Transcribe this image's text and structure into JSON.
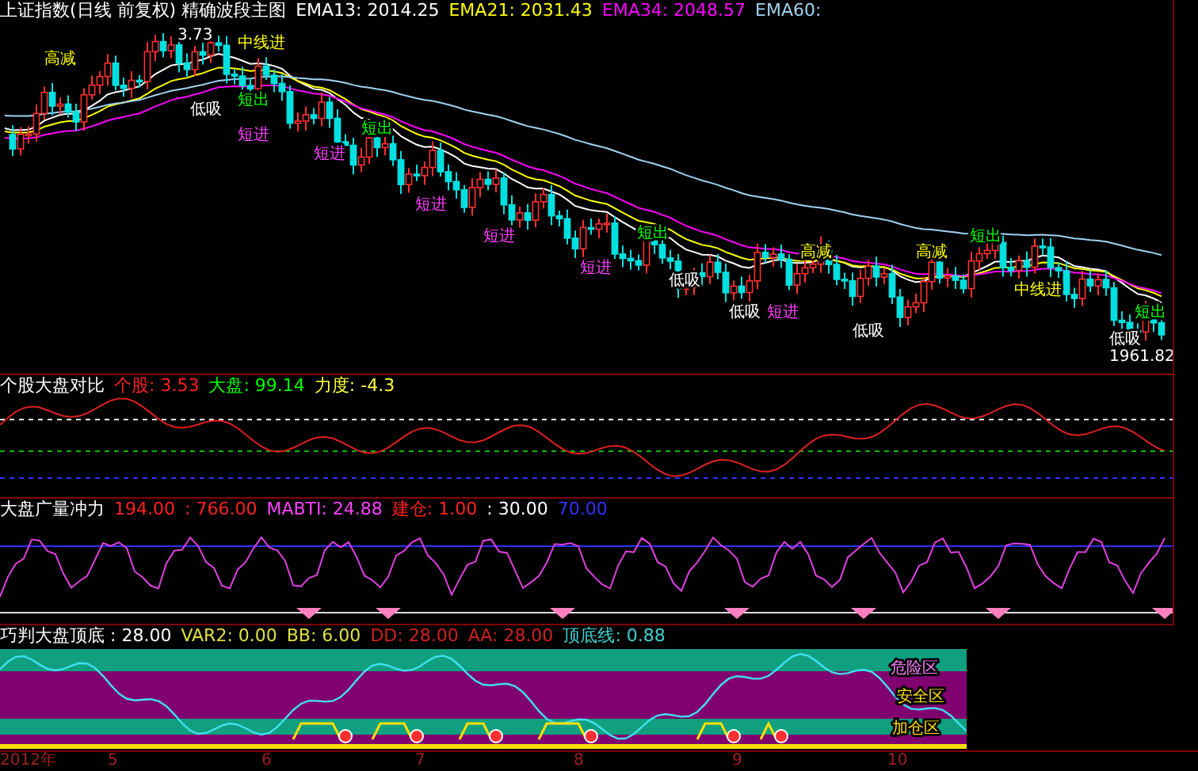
{
  "main_chart": {
    "title": "上证指数(日线 前复权) 精确波段主图",
    "indicators": [
      {
        "label": "EMA13: 2014.25",
        "color": "#ffffff"
      },
      {
        "label": "EMA21: 2031.43",
        "color": "#ffff00"
      },
      {
        "label": "EMA34: 2048.57",
        "color": "#ff00ff"
      },
      {
        "label": "EMA60:",
        "color": "#9fd3f0"
      }
    ],
    "price_labels": [
      "3.73",
      "1961.82"
    ],
    "signals": [
      {
        "text": "高减",
        "color": "#ffff00"
      },
      {
        "text": "中线进",
        "color": "#ffff00"
      },
      {
        "text": "低吸",
        "color": "#ffffff"
      },
      {
        "text": "短出",
        "color": "#00ff00"
      },
      {
        "text": "短进",
        "color": "#ff40ff"
      },
      {
        "text": "短出",
        "color": "#00ff00"
      },
      {
        "text": "短进",
        "color": "#ff40ff"
      },
      {
        "text": "短进",
        "color": "#ff40ff"
      },
      {
        "text": "短进",
        "color": "#ff40ff"
      },
      {
        "text": "短进",
        "color": "#ff40ff"
      },
      {
        "text": "短出",
        "color": "#00ff00"
      },
      {
        "text": "低吸",
        "color": "#ffffff"
      },
      {
        "text": "低吸",
        "color": "#ffffff"
      },
      {
        "text": "短进",
        "color": "#ff40ff"
      },
      {
        "text": "高减",
        "color": "#ffff00"
      },
      {
        "text": "低吸",
        "color": "#ffffff"
      },
      {
        "text": "高减",
        "color": "#ffff00"
      },
      {
        "text": "短出",
        "color": "#00ff00"
      },
      {
        "text": "中线进",
        "color": "#ffff00"
      },
      {
        "text": "低吸",
        "color": "#ffffff"
      },
      {
        "text": "短出",
        "color": "#00ff00"
      }
    ]
  },
  "compare_panel": {
    "title": "个股大盘对比",
    "values": [
      {
        "label": "个股: 3.53",
        "color": "#ff2020"
      },
      {
        "label": "大盘: 99.14",
        "color": "#00ff00"
      },
      {
        "label": "力度: -4.3",
        "color": "#ffff40"
      }
    ]
  },
  "volume_panel": {
    "title": "大盘广量冲力",
    "values": [
      {
        "label": "194.00",
        "color": "#ff2020"
      },
      {
        "label": ": 766.00",
        "color": "#ff2020"
      },
      {
        "label": "MABTI: 24.88",
        "color": "#ff40ff"
      },
      {
        "label": "建仓: 1.00",
        "color": "#ff2020"
      },
      {
        "label": ": 30.00",
        "color": "#ffffff"
      },
      {
        "label": "70.00",
        "color": "#3030ff"
      }
    ]
  },
  "top_bottom_panel": {
    "title": "巧判大盘顶底 : 28.00",
    "values": [
      {
        "label": "VAR2: 0.00",
        "color": "#e0e040"
      },
      {
        "label": "BB: 6.00",
        "color": "#e0e040"
      },
      {
        "label": "DD: 28.00",
        "color": "#d02020"
      },
      {
        "label": "AA: 28.00",
        "color": "#d02020"
      },
      {
        "label": "顶底线: 0.88",
        "color": "#40d0d0"
      }
    ],
    "zones": [
      "危险区",
      "安全区",
      "加仓区"
    ]
  },
  "x_axis": [
    "2012年",
    "5",
    "6",
    "7",
    "8",
    "9",
    "10"
  ]
}
